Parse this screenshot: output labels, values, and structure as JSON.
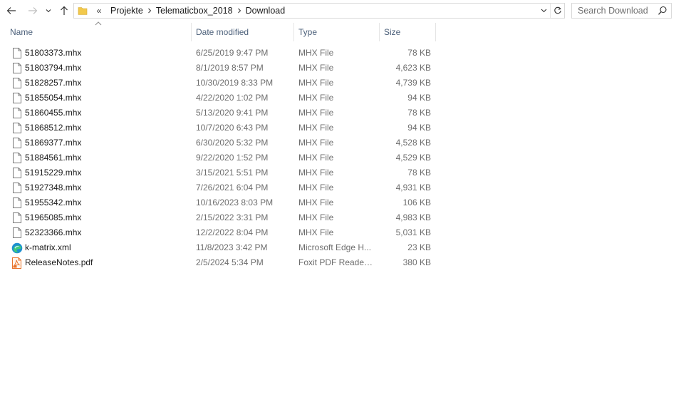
{
  "nav": {
    "back_icon": "back-arrow-icon",
    "forward_icon": "forward-arrow-icon",
    "recent_icon": "chevron-down-icon",
    "up_icon": "up-arrow-icon"
  },
  "address": {
    "overflow": "«",
    "breadcrumbs": [
      "Projekte",
      "Telematicbox_2018",
      "Download"
    ]
  },
  "search": {
    "placeholder": "Search Download"
  },
  "columns": {
    "name": "Name",
    "date": "Date modified",
    "type": "Type",
    "size": "Size"
  },
  "files": [
    {
      "icon": "file-icon",
      "name": "51803373.mhx",
      "date": "6/25/2019 9:47 PM",
      "type": "MHX File",
      "size": "78 KB"
    },
    {
      "icon": "file-icon",
      "name": "51803794.mhx",
      "date": "8/1/2019 8:57 PM",
      "type": "MHX File",
      "size": "4,623 KB"
    },
    {
      "icon": "file-icon",
      "name": "51828257.mhx",
      "date": "10/30/2019 8:33 PM",
      "type": "MHX File",
      "size": "4,739 KB"
    },
    {
      "icon": "file-icon",
      "name": "51855054.mhx",
      "date": "4/22/2020 1:02 PM",
      "type": "MHX File",
      "size": "94 KB"
    },
    {
      "icon": "file-icon",
      "name": "51860455.mhx",
      "date": "5/13/2020 9:41 PM",
      "type": "MHX File",
      "size": "78 KB"
    },
    {
      "icon": "file-icon",
      "name": "51868512.mhx",
      "date": "10/7/2020 6:43 PM",
      "type": "MHX File",
      "size": "94 KB"
    },
    {
      "icon": "file-icon",
      "name": "51869377.mhx",
      "date": "6/30/2020 5:32 PM",
      "type": "MHX File",
      "size": "4,528 KB"
    },
    {
      "icon": "file-icon",
      "name": "51884561.mhx",
      "date": "9/22/2020 1:52 PM",
      "type": "MHX File",
      "size": "4,529 KB"
    },
    {
      "icon": "file-icon",
      "name": "51915229.mhx",
      "date": "3/15/2021 5:51 PM",
      "type": "MHX File",
      "size": "78 KB"
    },
    {
      "icon": "file-icon",
      "name": "51927348.mhx",
      "date": "7/26/2021 6:04 PM",
      "type": "MHX File",
      "size": "4,931 KB"
    },
    {
      "icon": "file-icon",
      "name": "51955342.mhx",
      "date": "10/16/2023 8:03 PM",
      "type": "MHX File",
      "size": "106 KB"
    },
    {
      "icon": "file-icon",
      "name": "51965085.mhx",
      "date": "2/15/2022 3:31 PM",
      "type": "MHX File",
      "size": "4,983 KB"
    },
    {
      "icon": "file-icon",
      "name": "52323366.mhx",
      "date": "12/2/2022 8:04 PM",
      "type": "MHX File",
      "size": "5,031 KB"
    },
    {
      "icon": "edge-icon",
      "name": "k-matrix.xml",
      "date": "11/8/2023 3:42 PM",
      "type": "Microsoft Edge H...",
      "size": "23 KB"
    },
    {
      "icon": "pdf-icon",
      "name": "ReleaseNotes.pdf",
      "date": "2/5/2024 5:34 PM",
      "type": "Foxit PDF Reader ...",
      "size": "380 KB"
    }
  ],
  "colors": {
    "header_text": "#4c607a",
    "secondary_text": "#6d6d6d",
    "folder": "#f2c94c",
    "edge": "#1d8fd1",
    "pdf": "#e8742c"
  }
}
